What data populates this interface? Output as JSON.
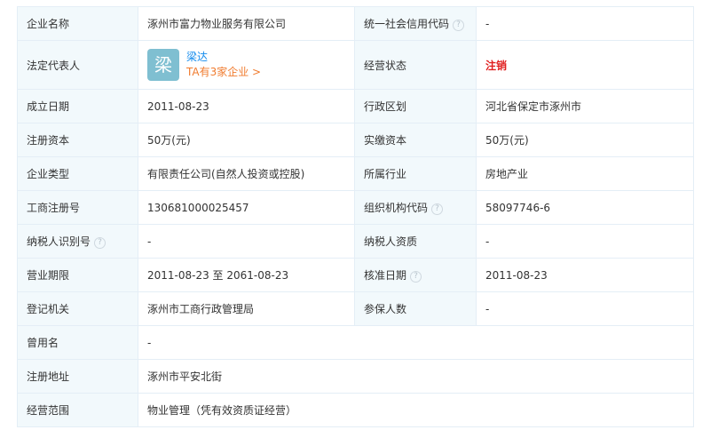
{
  "rows": [
    {
      "l1": "企业名称",
      "v1": "涿州市富力物业服务有限公司",
      "l2": "统一社会信用代码",
      "v2": "-"
    },
    {
      "l1": "法定代表人",
      "rep": {
        "avatar": "梁",
        "name": "梁达",
        "link": "TA有3家企业 >"
      },
      "l2": "经营状态",
      "v2": "注销"
    },
    {
      "l1": "成立日期",
      "v1": "2011-08-23",
      "l2": "行政区划",
      "v2": "河北省保定市涿州市"
    },
    {
      "l1": "注册资本",
      "v1": "50万(元)",
      "l2": "实缴资本",
      "v2": "50万(元)"
    },
    {
      "l1": "企业类型",
      "v1": "有限责任公司(自然人投资或控股)",
      "l2": "所属行业",
      "v2": "房地产业"
    },
    {
      "l1": "工商注册号",
      "v1": "130681000025457",
      "l2": "组织机构代码",
      "v2": "58097746-6"
    },
    {
      "l1": "纳税人识别号",
      "v1": "-",
      "l2": "纳税人资质",
      "v2": "-"
    },
    {
      "l1": "营业期限",
      "v1": "2011-08-23 至 2061-08-23",
      "l2": "核准日期",
      "v2": "2011-08-23"
    },
    {
      "l1": "登记机关",
      "v1": "涿州市工商行政管理局",
      "l2": "参保人数",
      "v2": "-"
    },
    {
      "l1": "曾用名",
      "v1": "-"
    },
    {
      "l1": "注册地址",
      "v1": "涿州市平安北街"
    },
    {
      "l1": "经营范围",
      "v1": "物业管理（凭有效资质证经营）"
    }
  ],
  "help_glyph": "?",
  "colors": {
    "label_bg": "#f2f9fc",
    "border": "#e4eef6",
    "link": "#128bed",
    "orange": "#f07b2e",
    "status_red": "#e02020",
    "avatar_bg": "#7fbfd1"
  }
}
